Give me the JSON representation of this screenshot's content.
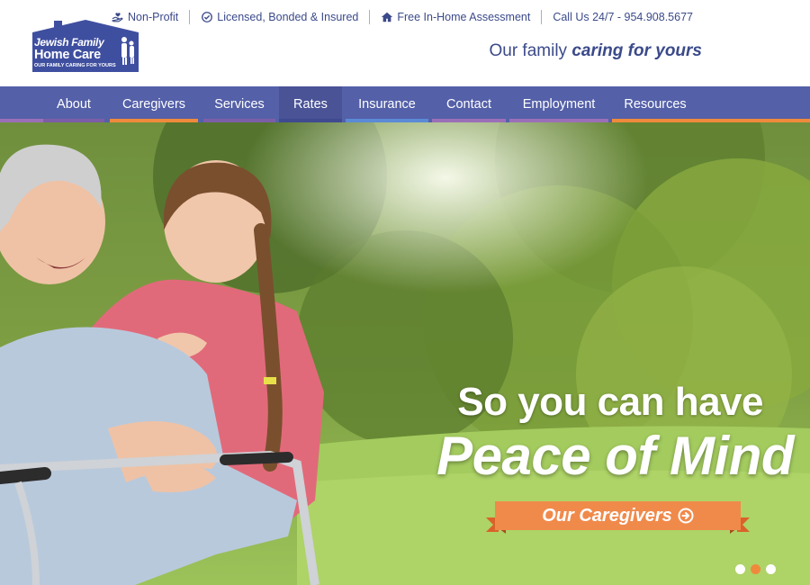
{
  "logo": {
    "line1": "Jewish Family",
    "line2": "Home Care",
    "line3": "OUR FAMILY CARING FOR YOURS"
  },
  "topbar": {
    "items": [
      {
        "icon": "hand-heart-icon",
        "label": "Non-Profit"
      },
      {
        "icon": "check-circle-icon",
        "label": "Licensed, Bonded & Insured"
      },
      {
        "icon": "home-icon",
        "label": "Free In-Home Assessment"
      },
      {
        "icon": "phone-icon",
        "label": "Call Us 24/7 - 954.908.5677"
      }
    ]
  },
  "tagline": {
    "prefix": "Our family ",
    "emphasis": "caring for yours"
  },
  "nav": {
    "items": [
      {
        "label": "About",
        "underline": "#7b5ea7"
      },
      {
        "label": "Caregivers",
        "underline": "#ef8a3c"
      },
      {
        "label": "Services",
        "underline": "#7b5ea7"
      },
      {
        "label": "Rates",
        "underline": "#ef8a3c",
        "active": true
      },
      {
        "label": "Insurance",
        "underline": "#5b8ad6"
      },
      {
        "label": "Contact",
        "underline": "#7b5ea7"
      },
      {
        "label": "Employment",
        "underline": "#9b6fb8"
      },
      {
        "label": "Resources",
        "underline": "#ef8a3c"
      }
    ]
  },
  "hero": {
    "title_line1": "So you can have",
    "title_line2": "Peace of Mind",
    "cta_label": "Our Caregivers",
    "cta_icon": "arrow-circle-right-icon",
    "slides": [
      {
        "state": "inactive"
      },
      {
        "state": "active"
      },
      {
        "state": "inactive"
      }
    ]
  },
  "colors": {
    "brand": "#5460a8",
    "brand_text": "#3b4a8a",
    "accent_orange": "#ef8a3c",
    "cta_orange": "#f08a4b"
  }
}
